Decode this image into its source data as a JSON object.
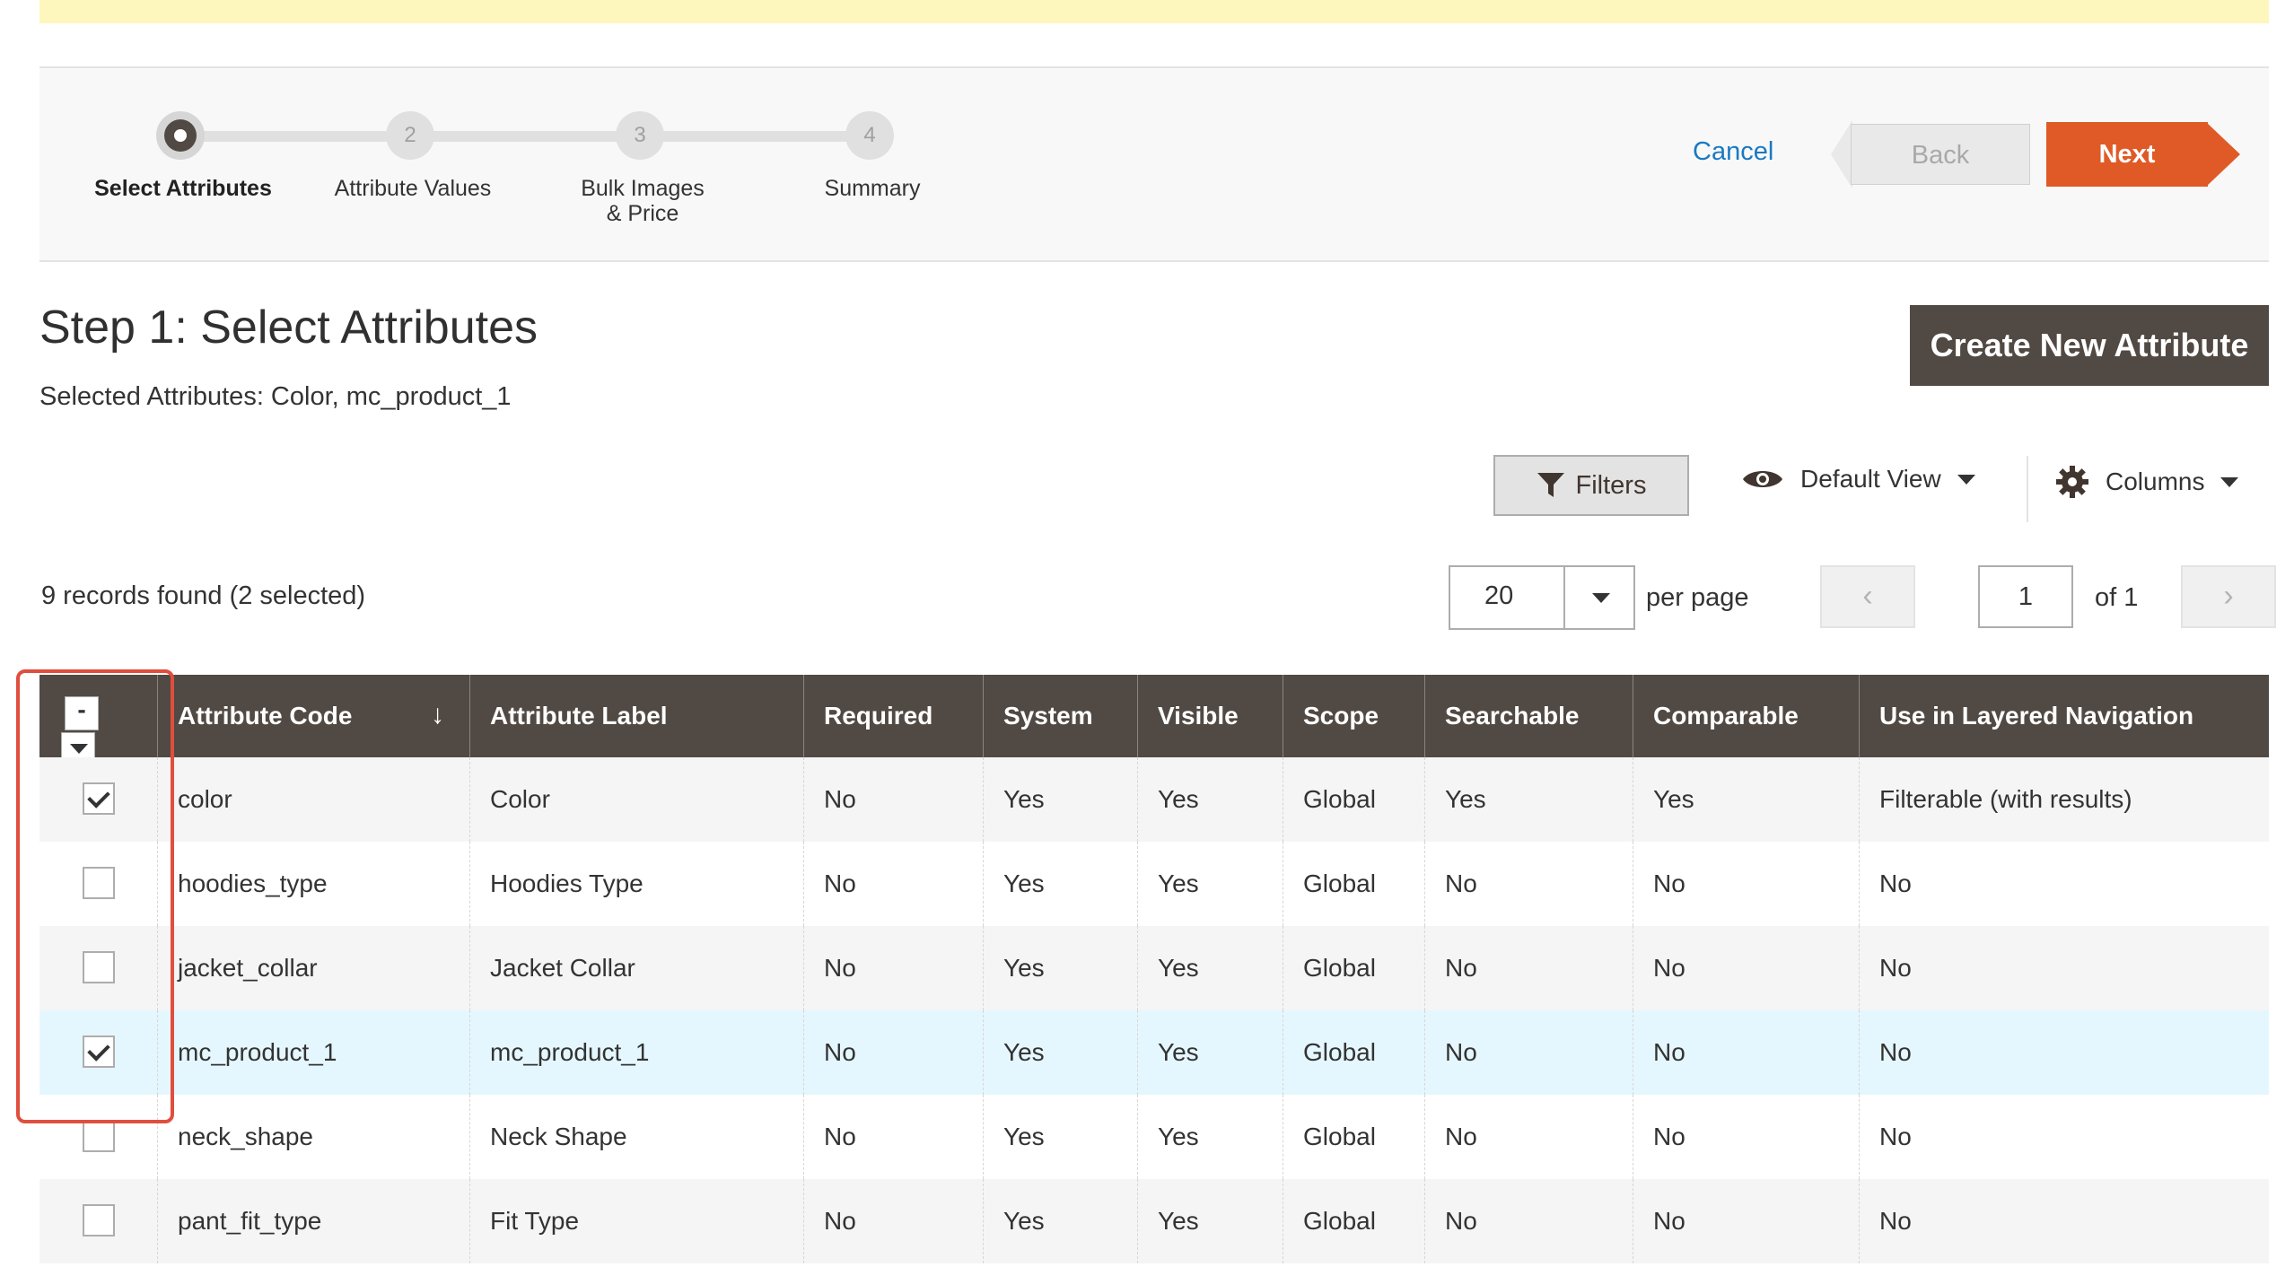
{
  "wizard": {
    "steps": [
      {
        "number": "",
        "label": "Select Attributes"
      },
      {
        "number": "2",
        "label": "Attribute Values"
      },
      {
        "number": "3",
        "label": "Bulk Images & Price"
      },
      {
        "number": "4",
        "label": "Summary"
      }
    ],
    "cancel_label": "Cancel",
    "back_label": "Back",
    "next_label": "Next"
  },
  "page": {
    "title": "Step 1: Select Attributes",
    "selected_text": "Selected Attributes: Color, mc_product_1",
    "create_button": "Create New Attribute"
  },
  "toolbar": {
    "filters_label": "Filters",
    "view_label": "Default View",
    "columns_label": "Columns",
    "records_text": "9 records found (2 selected)",
    "per_page_value": "20",
    "per_page_label": "per page",
    "page_value": "1",
    "page_of": "of 1",
    "prev_glyph": "‹",
    "next_glyph": "›"
  },
  "grid": {
    "mass_action_glyph": "-",
    "sort_glyph": "↓",
    "columns": [
      "Attribute Code",
      "Attribute Label",
      "Required",
      "System",
      "Visible",
      "Scope",
      "Searchable",
      "Comparable",
      "Use in Layered Navigation"
    ],
    "rows": [
      {
        "checked": true,
        "cells": [
          "color",
          "Color",
          "No",
          "Yes",
          "Yes",
          "Global",
          "Yes",
          "Yes",
          "Filterable (with results)"
        ]
      },
      {
        "checked": false,
        "cells": [
          "hoodies_type",
          "Hoodies Type",
          "No",
          "Yes",
          "Yes",
          "Global",
          "No",
          "No",
          "No"
        ]
      },
      {
        "checked": false,
        "cells": [
          "jacket_collar",
          "Jacket Collar",
          "No",
          "Yes",
          "Yes",
          "Global",
          "No",
          "No",
          "No"
        ]
      },
      {
        "checked": true,
        "cells": [
          "mc_product_1",
          "mc_product_1",
          "No",
          "Yes",
          "Yes",
          "Global",
          "No",
          "No",
          "No"
        ]
      },
      {
        "checked": false,
        "cells": [
          "neck_shape",
          "Neck Shape",
          "No",
          "Yes",
          "Yes",
          "Global",
          "No",
          "No",
          "No"
        ]
      },
      {
        "checked": false,
        "cells": [
          "pant_fit_type",
          "Fit Type",
          "No",
          "Yes",
          "Yes",
          "Global",
          "No",
          "No",
          "No"
        ]
      }
    ]
  },
  "colors": {
    "header_bg": "#514943",
    "next_btn": "#e05a27",
    "link": "#1979c3",
    "highlight_box": "#e04e3d",
    "selected_row": "#e5f7fe"
  }
}
